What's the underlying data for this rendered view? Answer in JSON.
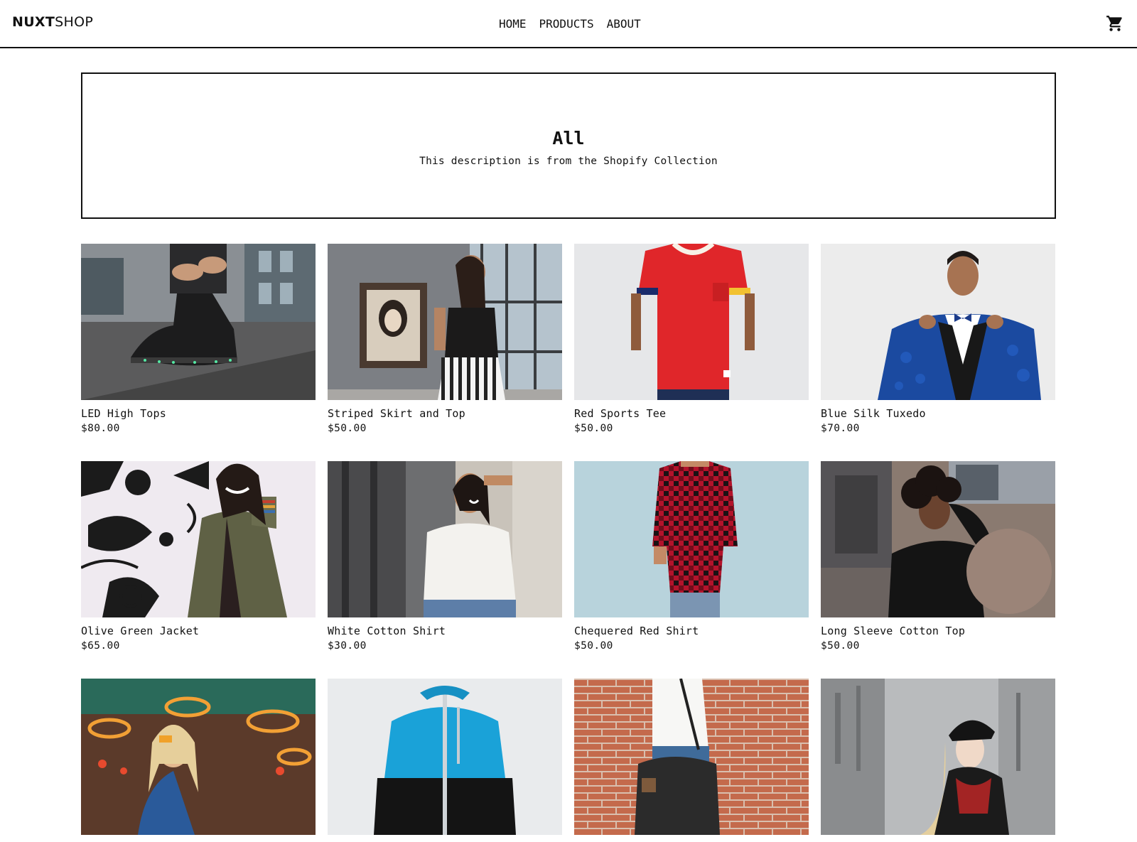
{
  "header": {
    "logo_bold": "NUXT",
    "logo_light": "SHOP",
    "nav": [
      "HOME",
      "PRODUCTS",
      "ABOUT"
    ],
    "cart_icon": "shopping-cart-icon"
  },
  "collection": {
    "title": "All",
    "description": "This description is from the Shopify Collection"
  },
  "products": [
    {
      "title": "LED High Tops",
      "price": "$80.00"
    },
    {
      "title": "Striped Skirt and Top",
      "price": "$50.00"
    },
    {
      "title": "Red Sports Tee",
      "price": "$50.00"
    },
    {
      "title": "Blue Silk Tuxedo",
      "price": "$70.00"
    },
    {
      "title": "Olive Green Jacket",
      "price": "$65.00"
    },
    {
      "title": "White Cotton Shirt",
      "price": "$30.00"
    },
    {
      "title": "Chequered Red Shirt",
      "price": "$50.00"
    },
    {
      "title": "Long Sleeve Cotton Top",
      "price": "$50.00"
    },
    {
      "title": "",
      "price": ""
    },
    {
      "title": "",
      "price": ""
    },
    {
      "title": "",
      "price": ""
    },
    {
      "title": "",
      "price": ""
    }
  ],
  "colors": {
    "text": "#111111",
    "border": "#111111",
    "background": "#ffffff"
  }
}
